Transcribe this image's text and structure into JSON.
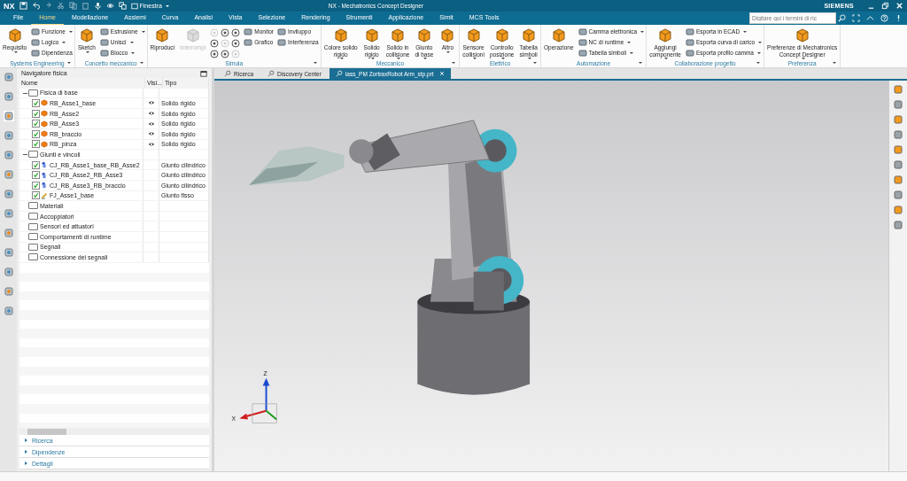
{
  "title_bar": {
    "logo": "NX",
    "window_menu": "Finestra",
    "title": "NX - Mechatronics Concept Designer",
    "brand": "SIEMENS"
  },
  "menu_tabs": [
    {
      "label": "File",
      "selected": false
    },
    {
      "label": "Home",
      "selected": true
    },
    {
      "label": "Modellazione",
      "selected": false
    },
    {
      "label": "Assiemi",
      "selected": false
    },
    {
      "label": "Curva",
      "selected": false
    },
    {
      "label": "Analisi",
      "selected": false
    },
    {
      "label": "Vista",
      "selected": false
    },
    {
      "label": "Selezione",
      "selected": false
    },
    {
      "label": "Rendering",
      "selected": false
    },
    {
      "label": "Strumenti",
      "selected": false
    },
    {
      "label": "Applicazione",
      "selected": false
    },
    {
      "label": "Simit",
      "selected": false
    },
    {
      "label": "MCS Tools",
      "selected": false
    }
  ],
  "search": {
    "placeholder": "Digitare qui i termini di ric"
  },
  "ribbon": [
    {
      "label": "Systems Engineering",
      "columns": [
        {
          "kind": "large",
          "items": [
            {
              "label": "Requisito",
              "dropdown": true,
              "disabled": false
            }
          ]
        },
        {
          "kind": "stack",
          "items": [
            {
              "label": "Funzione",
              "dropdown": true,
              "disabled": false
            },
            {
              "label": "Logico",
              "dropdown": true,
              "disabled": false
            },
            {
              "label": "Dipendenza",
              "dropdown": false,
              "disabled": false
            }
          ]
        }
      ]
    },
    {
      "label": "Concetto meccanico",
      "columns": [
        {
          "kind": "large",
          "items": [
            {
              "label": "Sketch",
              "dropdown": true,
              "disabled": false
            }
          ]
        },
        {
          "kind": "stack",
          "items": [
            {
              "label": "Estrusione",
              "dropdown": true,
              "disabled": false
            },
            {
              "label": "Unisci",
              "dropdown": true,
              "disabled": false
            },
            {
              "label": "Blocco",
              "dropdown": true,
              "disabled": false
            }
          ]
        }
      ]
    },
    {
      "label": "Simula",
      "columns": [
        {
          "kind": "large",
          "items": [
            {
              "label": "Riproduci",
              "dropdown": false,
              "disabled": false
            }
          ]
        },
        {
          "kind": "large",
          "items": [
            {
              "label": "Interrompi",
              "dropdown": false,
              "disabled": true
            }
          ]
        },
        {
          "kind": "grid",
          "items": [
            {
              "disabled": true
            },
            {
              "disabled": false
            },
            {
              "disabled": false
            },
            {
              "disabled": false
            },
            {
              "disabled": true
            },
            {
              "disabled": false
            },
            {
              "disabled": false
            },
            {
              "disabled": false
            },
            {
              "disabled": true
            }
          ]
        },
        {
          "kind": "stack",
          "items": [
            {
              "label": "Monitor",
              "dropdown": false,
              "disabled": false
            },
            {
              "label": "Grafico",
              "dropdown": false,
              "disabled": false
            }
          ]
        },
        {
          "kind": "stack",
          "items": [
            {
              "label": "Inviluppo",
              "dropdown": false,
              "disabled": false
            },
            {
              "label": "Interferenza",
              "dropdown": false,
              "disabled": false
            }
          ]
        }
      ]
    },
    {
      "label": "Meccanico",
      "columns": [
        {
          "kind": "large",
          "items": [
            {
              "label": "Colore solido\nrigido",
              "dropdown": true,
              "disabled": false
            }
          ]
        },
        {
          "kind": "large",
          "items": [
            {
              "label": "Solido\nrigido",
              "dropdown": true,
              "disabled": false
            }
          ]
        },
        {
          "kind": "large",
          "items": [
            {
              "label": "Solido in\ncollisione",
              "dropdown": true,
              "disabled": false
            }
          ]
        },
        {
          "kind": "large",
          "items": [
            {
              "label": "Giunto\ndi base",
              "dropdown": true,
              "disabled": false
            }
          ]
        },
        {
          "kind": "large",
          "items": [
            {
              "label": "Altro",
              "dropdown": true,
              "disabled": false
            }
          ]
        }
      ]
    },
    {
      "label": "Elettrico",
      "columns": [
        {
          "kind": "large",
          "items": [
            {
              "label": "Sensore\ncollisioni",
              "dropdown": true,
              "disabled": false
            }
          ]
        },
        {
          "kind": "large",
          "items": [
            {
              "label": "Controllo\nposizione",
              "dropdown": true,
              "disabled": false
            }
          ]
        },
        {
          "kind": "large",
          "items": [
            {
              "label": "Tabella\nsimboli",
              "dropdown": true,
              "disabled": false
            }
          ]
        }
      ]
    },
    {
      "label": "Automazione",
      "columns": [
        {
          "kind": "large",
          "items": [
            {
              "label": "Operazione",
              "dropdown": false,
              "disabled": false
            }
          ]
        },
        {
          "kind": "stack",
          "items": [
            {
              "label": "Camma elettronica",
              "dropdown": true,
              "disabled": false
            },
            {
              "label": "NC di runtime",
              "dropdown": true,
              "disabled": false
            },
            {
              "label": "Tabella simboli",
              "dropdown": true,
              "disabled": false
            }
          ]
        }
      ]
    },
    {
      "label": "Collaborazione progetto",
      "columns": [
        {
          "kind": "large",
          "items": [
            {
              "label": "Aggiungi\ncomponente",
              "dropdown": true,
              "disabled": false
            }
          ]
        },
        {
          "kind": "stack",
          "items": [
            {
              "label": "Esporta in ECAD",
              "dropdown": true,
              "disabled": false
            },
            {
              "label": "Esporta curva di carico",
              "dropdown": true,
              "disabled": false
            },
            {
              "label": "Esporta profilo camma",
              "dropdown": true,
              "disabled": false
            }
          ]
        }
      ]
    },
    {
      "label": "Preferenza",
      "columns": [
        {
          "kind": "large",
          "items": [
            {
              "label": "Preferenze di Mechatronics\nConcept Designer",
              "dropdown": true,
              "disabled": false
            }
          ]
        }
      ]
    }
  ],
  "doc_tabs": [
    {
      "label": "Ricerca",
      "selected": false
    },
    {
      "label": "Discovery Center",
      "selected": false
    },
    {
      "label": "lass_PM ZortraxRobot Arm_stp.prt",
      "selected": true
    }
  ],
  "navigator": {
    "title": "Navigatore fisica",
    "columns": [
      "Nome",
      "Visi...",
      "Tipo"
    ],
    "tree": [
      {
        "label": "Fisica di base",
        "expanded": true,
        "children": [
          {
            "label": "RB_Asse1_base",
            "kind": "body",
            "checked": true,
            "visible": true,
            "type": "Solido rigido"
          },
          {
            "label": "RB_Asse2",
            "kind": "body",
            "checked": true,
            "visible": true,
            "type": "Solido rigido"
          },
          {
            "label": "RB_Asse3",
            "kind": "body",
            "checked": true,
            "visible": true,
            "type": "Solido rigido"
          },
          {
            "label": "RB_braccio",
            "kind": "body",
            "checked": true,
            "visible": true,
            "type": "Solido rigido"
          },
          {
            "label": "RB_pinza",
            "kind": "body",
            "checked": true,
            "visible": true,
            "type": "Solido rigido"
          }
        ]
      },
      {
        "label": "Giunti e vincoli",
        "expanded": true,
        "children": [
          {
            "label": "CJ_RB_Asse1_base_RB_Asse2",
            "kind": "joint",
            "checked": true,
            "visible": false,
            "type": "Giunto cilindrico"
          },
          {
            "label": "CJ_RB_Asse2_RB_Asse3",
            "kind": "joint",
            "checked": true,
            "visible": false,
            "type": "Giunto cilindrico"
          },
          {
            "label": "CJ_RB_Asse3_RB_braccio",
            "kind": "joint",
            "checked": true,
            "visible": false,
            "type": "Giunto cilindrico"
          },
          {
            "label": "FJ_Asse1_base",
            "kind": "fixed",
            "checked": true,
            "visible": false,
            "type": "Giunto fisso"
          }
        ]
      },
      {
        "label": "Materiali"
      },
      {
        "label": "Accoppiatori"
      },
      {
        "label": "Sensori ed attuatori"
      },
      {
        "label": "Comportamenti di runtime"
      },
      {
        "label": "Segnali"
      },
      {
        "label": "Connessione dei segnali"
      }
    ]
  },
  "bottom_sections": [
    {
      "label": "Ricerca",
      "expanded": false
    },
    {
      "label": "Dipendenze",
      "expanded": false
    },
    {
      "label": "Dettagli",
      "expanded": false
    }
  ],
  "triad": {
    "labels": [
      "Z",
      "X"
    ]
  }
}
